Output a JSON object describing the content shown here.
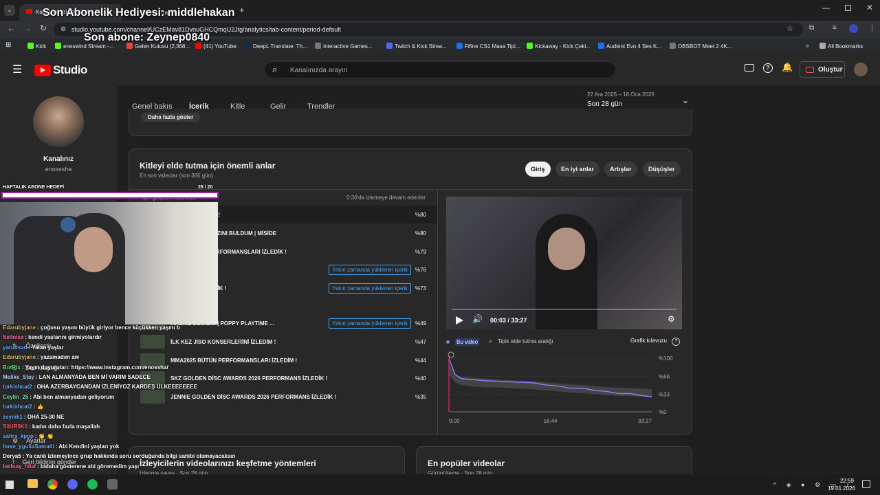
{
  "browser": {
    "tabs": [
      {
        "label": "Kanal analizi - YouTube St..."
      },
      {
        "label": "DeepL Translate: The world's m..."
      }
    ],
    "url": "studio.youtube.com/channel/UCzEMav81DvnuGHCQmqU2Jtg/analytics/tab-content/period-default",
    "bookmarks": [
      "Kick",
      "eneswind Stream -...",
      "Gelen Kutusu (2,368...",
      "(41) YouTube",
      "DeepL Translate: Th...",
      "Interactive Games...",
      "Twitch & Kick Strea...",
      "Fifine CS1 Masa Tipi...",
      "Kickaway - Kick Çeki...",
      "Audient Evo 4 Ses K...",
      "OBSBOT Meet 2 4K..."
    ],
    "all_bookmarks": "All Bookmarks"
  },
  "overlay": {
    "sub_gift": "Son Abonelik Hediyesi: middlehakan",
    "last_sub": "Son abone: Zeynep0840",
    "goal_label": "HAFTALIK ABONE HEDEFİ",
    "goal_count": "26 / 20",
    "goal_progress": 1.0
  },
  "studio": {
    "logo": "Studio",
    "search_placeholder": "Kanalınızda arayın",
    "create_label": "Oluştur",
    "channel_label": "Kanalınız",
    "channel_handle": "enosssha",
    "tabs": [
      "Genel bakış",
      "İçerik",
      "Kitle",
      "Gelir",
      "Trendler"
    ],
    "date_range": "22 Ara 2025 – 18 Oca 2026",
    "period": "Son 28 gün",
    "show_more": "Daha fazla göster",
    "card_title": "Kitleyi elde tutma için önemli anlar",
    "card_sub": "En son videolar (son 365 gün)",
    "filters": [
      "Giriş",
      "En iyi anlar",
      "Artışlar",
      "Düşüşler"
    ],
    "col_left": "Tipik girişlerin üzerinde",
    "col_right": "0:30'da izlemeye devam edenler",
    "rows": [
      {
        "title": "...AFİM DİNLEDİM !",
        "badge": "",
        "pct": "%80"
      },
      {
        "title": "...DİĞİM ANİME KIZINI BULDUM | MİSİDE",
        "badge": "",
        "pct": "%80"
      },
      {
        "title": "...ILBAŞI 2026 PERFORMANSLARI İZLEDİK !",
        "badge": "",
        "pct": "%79"
      },
      {
        "title": "...NLEDİM !",
        "badge": "Yakın zamanda yüklenen içerik",
        "pct": "%76"
      },
      {
        "title": "...RU VLOG İZLEDİK !",
        "badge": "Yakın zamanda yüklenen içerik",
        "pct": "%73"
      },
      {
        "title": "...ALNIZ DEĞİLİM | POPPY PLAYTIME ...",
        "badge": "Yakın zamanda yüklenen içerik",
        "pct": "%49"
      },
      {
        "title": "İLK KEZ JISO KONSERLERİNİ İZLEDİM !",
        "badge": "",
        "pct": "%47"
      },
      {
        "title": "MMA2025 BÜTÜN PERFORMANSLARI İZLEDİM !",
        "badge": "",
        "pct": "%44"
      },
      {
        "title": "SKZ GOLDEN DİSC AWARDS 2026 PERFORMANS İZLEDİK !",
        "badge": "",
        "pct": "%40"
      },
      {
        "title": "JENNIE GOLDEN DİSC AWARDS 2026 PERFORMANS İZLEDİK !",
        "badge": "",
        "pct": "%35"
      }
    ],
    "player_time": "00:03 / 33:27",
    "legend_this": "Bu video",
    "legend_typical": "Tipik elde tutma aralığı",
    "graph_guide": "Grafik kılavuzu",
    "y_ticks": [
      "%100",
      "%66",
      "%33",
      "%0"
    ],
    "x_ticks": [
      "0:00",
      "16:44",
      "33:27"
    ],
    "bottom_left_title": "İzleyicilerin videolarınızı keşfetme yöntemleri",
    "bottom_left_sub": "İzlenme sayısı · Son 28 gün",
    "bottom_right_title": "En popüler videolar",
    "bottom_right_sub": "Görüntüleme · Son 28 gün",
    "side_items": [
      "Özelleştir",
      "Ses kitaplığı",
      "Ayarlar",
      "Geri bildirim gönder"
    ]
  },
  "chat": [
    {
      "user": "Edarubyjane",
      "text": ": çoğusu yaşını büyük giriyor bence küçükken yaşını b",
      "color": "#e0b060"
    },
    {
      "user": "Selinisa",
      "text": ": kendi yaşlarını girmiyolardır",
      "color": "#ff66aa"
    },
    {
      "user": "yaruosan",
      "text": ": Yalan yaşlar",
      "color": "#66aaff"
    },
    {
      "user": "Edarubyjane",
      "text": ": yazamadım aw",
      "color": "#e0b060"
    },
    {
      "user": "BotRix",
      "text": ": Yayın duyuruları: https://www.instagram.com/enossha/",
      "color": "#55dd88"
    },
    {
      "user": "Melike_Stay",
      "text": ": LAN ALMANYADA BEN Mİ VARIM SADECE",
      "color": "#aaccff"
    },
    {
      "user": "turkishcat2",
      "text": ": OHA AZERBAYCANDAN İZLENİYOZ KARDEŞ ÜLKEEEEEEEE",
      "color": "#66aaff"
    },
    {
      "user": "Ceylin_25",
      "text": ": Abi ben almanyadan geliyorum",
      "color": "#77ddaa"
    },
    {
      "user": "turkishcat2",
      "text": ": 👍",
      "color": "#66aaff"
    },
    {
      "user": "zeynik1",
      "text": ": OHA 25-30 NE",
      "color": "#66aaff"
    },
    {
      "user": "S0UR0K0",
      "text": ": kadın daha fazla maşallah",
      "color": "#ff5566"
    },
    {
      "user": "sahra_kpop",
      "text": ": 👏 👏",
      "color": "#66aaff"
    },
    {
      "user": "buse_yguliaSamatli",
      "text": ": Abi Kendini yaşları yok",
      "color": "#66aaff"
    },
    {
      "user": "Derya5",
      "text": ": Ya canlı izlemeyince grup hakkında soru sorduğunda bilgi sahibi olamayacaksın",
      "color": "#ffffff"
    },
    {
      "user": "bellnay_hilal",
      "text": ": bidaha gösterene abi göremedim yaşı",
      "color": "#ff66aa"
    }
  ],
  "taskbar": {
    "time": "22:59",
    "date": "19.01.2026"
  },
  "chart_data": {
    "type": "line",
    "x": [
      0,
      60,
      120,
      240,
      360,
      480,
      600,
      720,
      840,
      960,
      1080,
      1200,
      1320,
      1440,
      1560,
      1680,
      1800,
      1920,
      2007
    ],
    "series": [
      {
        "values": [
          100,
          70,
          62,
          60,
          58,
          57,
          56,
          55,
          54,
          50,
          48,
          44,
          44,
          40,
          38,
          34,
          34,
          30,
          28
        ]
      }
    ],
    "typical_band": {
      "low": [
        70,
        55,
        50,
        47,
        46,
        45,
        44,
        43,
        42,
        40,
        38,
        36,
        35,
        33,
        31,
        30,
        29,
        28,
        27
      ],
      "high": [
        92,
        70,
        65,
        63,
        62,
        60,
        59,
        58,
        57,
        55,
        53,
        51,
        50,
        48,
        46,
        45,
        44,
        43,
        42
      ]
    },
    "ylim": [
      0,
      100
    ]
  }
}
